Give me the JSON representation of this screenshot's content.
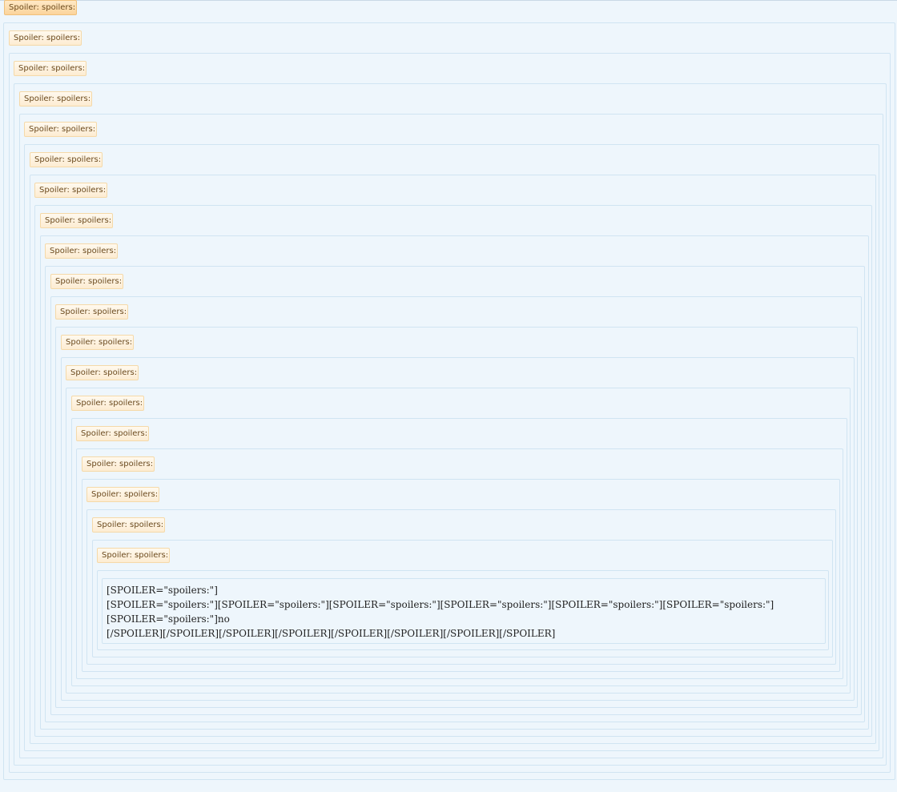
{
  "spoiler_label": "Spoiler: spoilers:",
  "content_lines": [
    "[SPOILER=\"spoilers:\"]",
    "[SPOILER=\"spoilers:\"][SPOILER=\"spoilers:\"][SPOILER=\"spoilers:\"][SPOILER=\"spoilers:\"][SPOILER=\"spoilers:\"][SPOILER=\"spoilers:\"]",
    "[SPOILER=\"spoilers:\"]no",
    "[/SPOILER][/SPOILER][/SPOILER][/SPOILER][/SPOILER][/SPOILER][/SPOILER][/SPOILER]"
  ]
}
